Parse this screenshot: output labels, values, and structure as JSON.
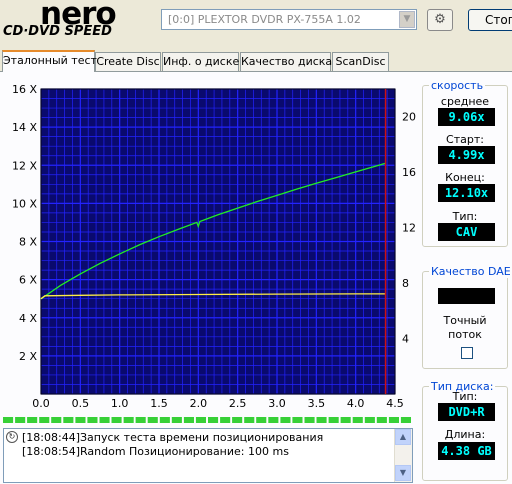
{
  "header": {
    "logo_main": "nero",
    "logo_sub": "CD·DVD SPEED",
    "drive_select": "[0:0]  PLEXTOR DVDR   PX-755A 1.02",
    "stop_label": "Стоп"
  },
  "tabs": [
    "Эталонный тест",
    "Create Disc",
    "Инф. о диске",
    "Качество диска",
    "ScanDisc"
  ],
  "active_tab": 0,
  "speed_panel": {
    "title": "скорость",
    "avg_label": "среднее",
    "avg_value": "9.06x",
    "start_label": "Старт:",
    "start_value": "4.99x",
    "end_label": "Конец:",
    "end_value": "12.10x",
    "type_label": "Тип:",
    "type_value": "CAV"
  },
  "dae_panel": {
    "title": "Качество DAE",
    "value": "",
    "accurate_label_1": "Точный",
    "accurate_label_2": "поток",
    "accurate_checked": false
  },
  "disc_panel": {
    "title": "Тип диска:",
    "type_label": "Тип:",
    "type_value": "DVD+R",
    "length_label": "Длина:",
    "length_value": "4.38 GB"
  },
  "log": [
    {
      "time": "[18:08:44]",
      "text": "Запуск теста времени позиционирования"
    },
    {
      "time": "[18:08:54]",
      "text": "Random Позиционирование: 100 ms"
    }
  ],
  "progress": {
    "segments_filled": 34,
    "segments_total": 34
  },
  "colors": {
    "plot_bg": "#0a0a6e",
    "grid": "#2323ff",
    "read_curve": "#22ee22",
    "rpm_curve": "#ffee44",
    "marker": "#cc1111",
    "value_text": "#00ffff"
  },
  "chart_data": {
    "type": "line",
    "x_ticks": [
      "0.0",
      "0.5",
      "1.0",
      "1.5",
      "2.0",
      "2.5",
      "3.0",
      "3.5",
      "4.0",
      "4.5"
    ],
    "y_left_ticks": [
      "2 X",
      "4 X",
      "6 X",
      "8 X",
      "10 X",
      "12 X",
      "14 X",
      "16 X"
    ],
    "y_right_ticks": [
      "4",
      "8",
      "12",
      "16",
      "20"
    ],
    "xlim": [
      0,
      4.5
    ],
    "ylim_left": [
      0,
      16
    ],
    "ylim_right": [
      0,
      22
    ],
    "grid": true,
    "end_marker_x": 4.38,
    "series": [
      {
        "x": [
          0.0,
          0.25,
          0.5,
          0.75,
          1.0,
          1.25,
          1.5,
          1.75,
          1.98,
          2.0,
          2.02,
          2.25,
          2.5,
          2.75,
          3.0,
          3.25,
          3.5,
          3.75,
          4.0,
          4.25,
          4.38
        ],
        "y": [
          4.99,
          5.7,
          6.3,
          6.85,
          7.35,
          7.82,
          8.25,
          8.65,
          9.0,
          8.8,
          9.05,
          9.4,
          9.75,
          10.1,
          10.42,
          10.75,
          11.06,
          11.35,
          11.65,
          11.95,
          12.1
        ]
      },
      {
        "x": [
          0.0,
          0.05,
          0.5,
          1.0,
          2.0,
          3.0,
          4.0,
          4.38
        ],
        "y": [
          5.0,
          5.15,
          5.18,
          5.2,
          5.22,
          5.24,
          5.25,
          5.25
        ]
      }
    ]
  }
}
